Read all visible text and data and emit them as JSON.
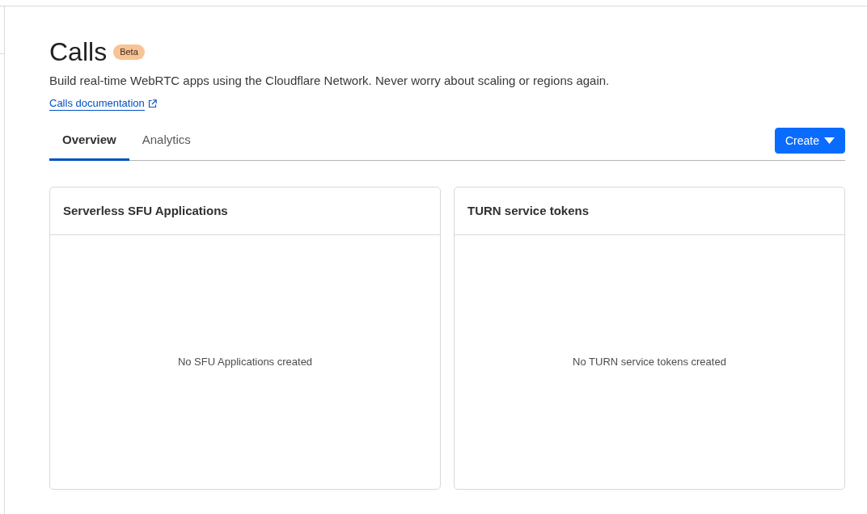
{
  "header": {
    "title": "Calls",
    "badge": "Beta",
    "description": "Build real-time WebRTC apps using the Cloudflare Network. Never worry about scaling or regions again.",
    "link": {
      "label": "Calls documentation"
    }
  },
  "tabs": [
    {
      "label": "Overview",
      "selected": true
    },
    {
      "label": "Analytics",
      "selected": false
    }
  ],
  "create_button": {
    "label": "Create"
  },
  "cards": [
    {
      "title": "Serverless SFU Applications",
      "empty_message": "No SFU Applications created"
    },
    {
      "title": "TURN service tokens",
      "empty_message": "No TURN service tokens created"
    }
  ]
}
